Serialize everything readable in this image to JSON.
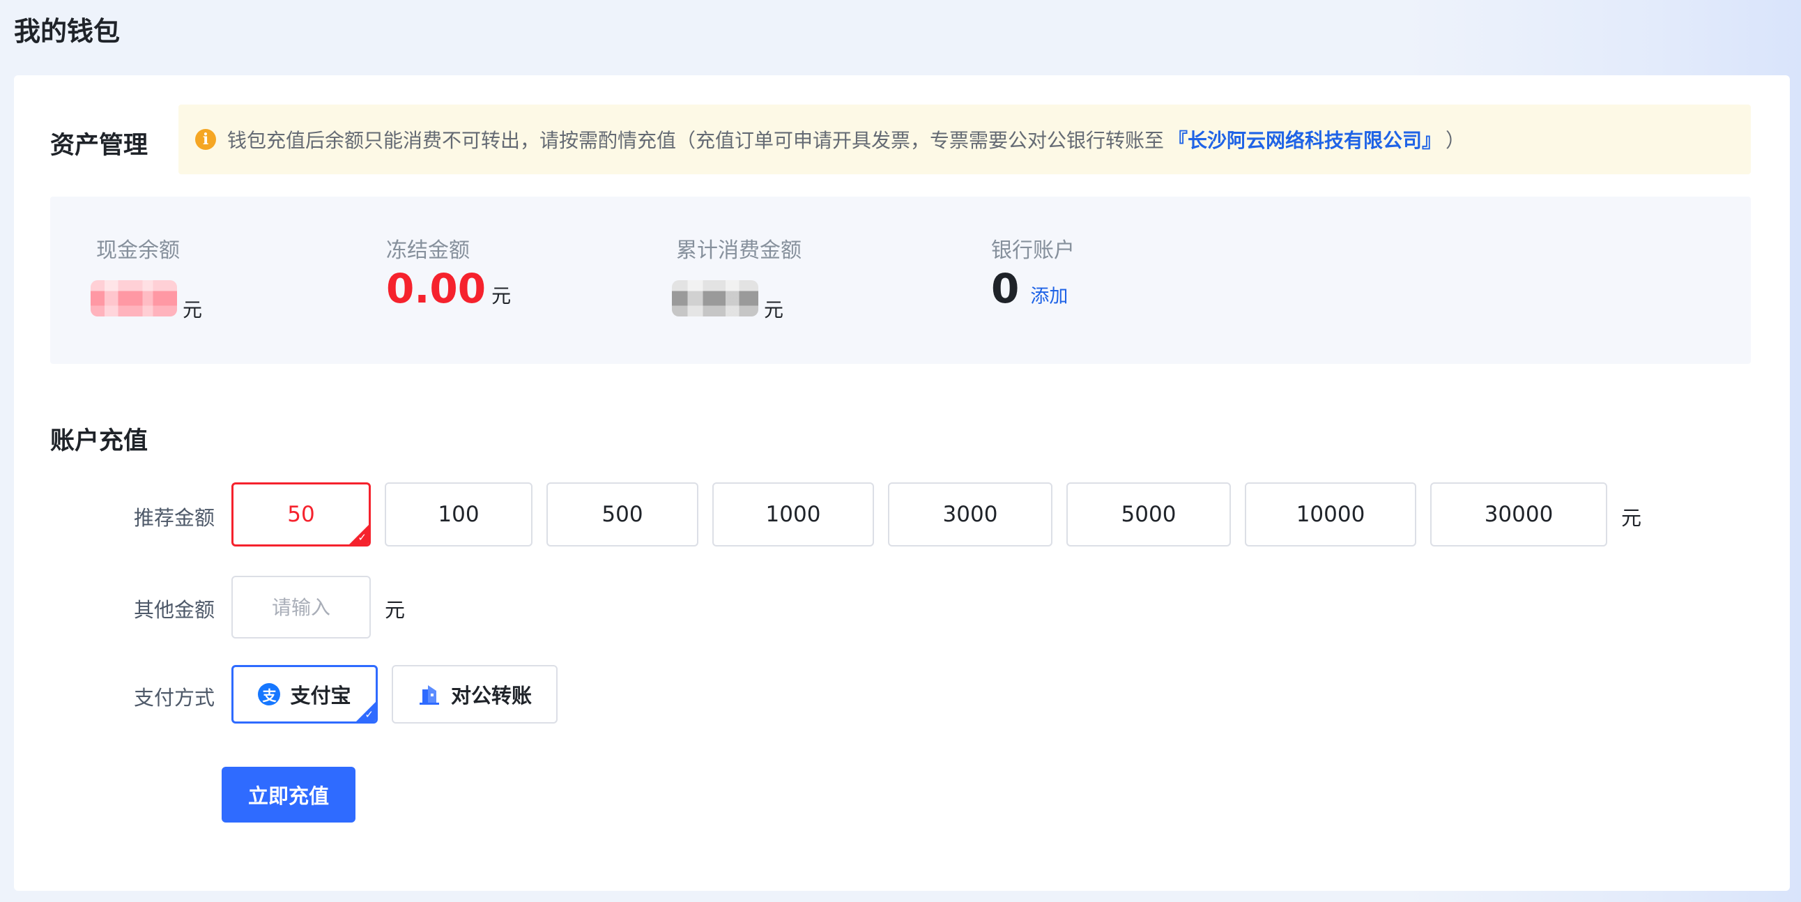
{
  "page": {
    "title": "我的钱包"
  },
  "assets": {
    "title": "资产管理",
    "notice": {
      "icon": "info-icon",
      "text_before": "钱包充值后余额只能消费不可转出，请按需酌情充值（充值订单可申请开具发票，专票需要公对公银行转账至",
      "link_text": "『长沙阿云网络科技有限公司』",
      "text_after": "）"
    },
    "stats": [
      {
        "label": "现金余额",
        "unit": "元"
      },
      {
        "label": "冻结金额",
        "value": "0.00",
        "unit": "元"
      },
      {
        "label": "累计消费金额",
        "unit": "元"
      },
      {
        "label": "银行账户",
        "value": "0",
        "action": "添加"
      }
    ]
  },
  "recharge": {
    "title": "账户充值",
    "preset_label": "推荐金额",
    "presets": [
      "50",
      "100",
      "500",
      "1000",
      "3000",
      "5000",
      "10000",
      "30000"
    ],
    "selected_preset": "50",
    "unit": "元",
    "other_label": "其他金额",
    "other_placeholder": "请输入",
    "other_unit": "元",
    "payment_label": "支付方式",
    "payment_methods": [
      {
        "label": "支付宝",
        "icon": "alipay-icon",
        "selected": true
      },
      {
        "label": "对公转账",
        "icon": "bank-building-icon",
        "selected": false
      }
    ],
    "submit_label": "立即充值"
  },
  "colors": {
    "accent": "#2f6bff",
    "danger": "#f5222d",
    "link": "#1f63e6",
    "notice_bg": "#fdf9e6",
    "warning": "#f5a623"
  }
}
